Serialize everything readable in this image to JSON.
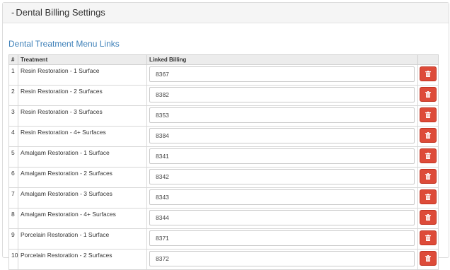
{
  "panel": {
    "toggle": "-",
    "title": "Dental Billing Settings"
  },
  "section_title": "Dental Treatment Menu Links",
  "table": {
    "headers": {
      "num": "#",
      "treatment": "Treatment",
      "linked": "Linked Billing",
      "actions": ""
    },
    "delete_icon": "trash-icon",
    "delete_color": "#dd4b39",
    "rows": [
      {
        "num": "1",
        "treatment": "Resin Restoration - 1 Surface",
        "billing": "8367"
      },
      {
        "num": "2",
        "treatment": "Resin Restoration - 2 Surfaces",
        "billing": "8382"
      },
      {
        "num": "3",
        "treatment": "Resin Restoration - 3 Surfaces",
        "billing": "8353"
      },
      {
        "num": "4",
        "treatment": "Resin Restoration - 4+ Surfaces",
        "billing": "8384"
      },
      {
        "num": "5",
        "treatment": "Amalgam Restoration - 1 Surface",
        "billing": "8341"
      },
      {
        "num": "6",
        "treatment": "Amalgam Restoration - 2 Surfaces",
        "billing": "8342"
      },
      {
        "num": "7",
        "treatment": "Amalgam Restoration - 3 Surfaces",
        "billing": "8343"
      },
      {
        "num": "8",
        "treatment": "Amalgam Restoration - 4+ Surfaces",
        "billing": "8344"
      },
      {
        "num": "9",
        "treatment": "Porcelain Restoration - 1 Surface",
        "billing": "8371"
      },
      {
        "num": "10",
        "treatment": "Porcelain Restoration - 2 Surfaces",
        "billing": "8372"
      }
    ]
  }
}
